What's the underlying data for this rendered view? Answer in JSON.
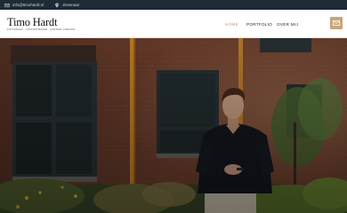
{
  "topbar": {
    "email": "info@timohardt.nl",
    "location": "Zevenaar"
  },
  "header": {
    "logo_name": "Timo Hardt",
    "logo_tagline": "FOTOGRAAF · CONTENTMAKER · CONTENT CREATOR"
  },
  "nav": {
    "items": [
      {
        "label": "HOME"
      },
      {
        "label": "PORTFOLIO"
      },
      {
        "label": "OVER MIJ"
      }
    ]
  },
  "colors": {
    "topbar_bg": "#1e2a35",
    "accent": "#c9a04a",
    "mail_button": "#c9a57a"
  },
  "icons": {
    "email": "mail-icon",
    "location": "map-pin-icon",
    "contact": "envelope-icon"
  }
}
